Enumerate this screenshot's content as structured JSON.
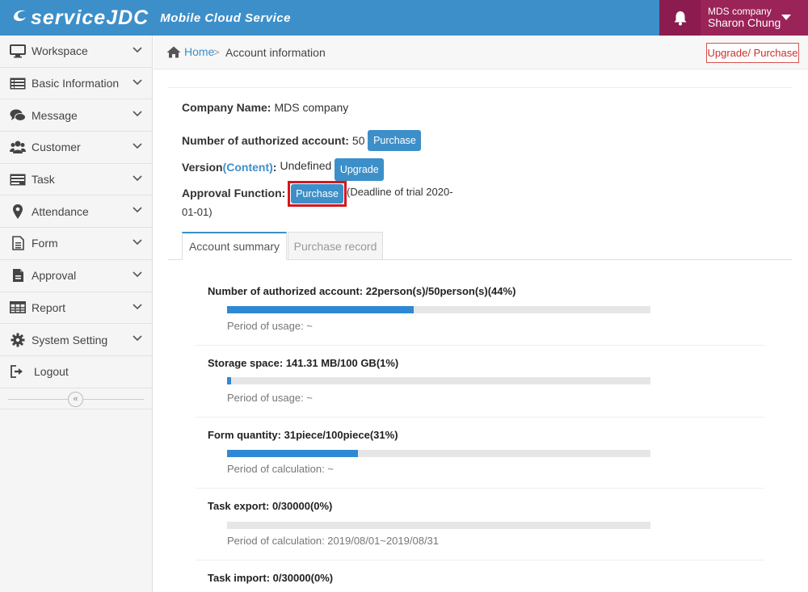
{
  "header": {
    "logo_text": "serviceJDC",
    "logo_sub": "Mobile Cloud Service",
    "user_company": "MDS company",
    "user_name": "Sharon Chung"
  },
  "sidebar": {
    "items": [
      {
        "label": "Workspace",
        "icon": "monitor-icon"
      },
      {
        "label": "Basic Information",
        "icon": "list-icon"
      },
      {
        "label": "Message",
        "icon": "chat-icon"
      },
      {
        "label": "Customer",
        "icon": "users-icon"
      },
      {
        "label": "Task",
        "icon": "task-icon"
      },
      {
        "label": "Attendance",
        "icon": "map-pin-icon"
      },
      {
        "label": "Form",
        "icon": "document-icon"
      },
      {
        "label": "Approval",
        "icon": "approval-doc-icon"
      },
      {
        "label": "Report",
        "icon": "table-icon"
      },
      {
        "label": "System Setting",
        "icon": "gear-icon"
      },
      {
        "label": "Logout",
        "icon": "logout-icon"
      }
    ],
    "collapse_glyph": "«"
  },
  "breadcrumb": {
    "home": "Home",
    "separator": ">",
    "current": "Account information",
    "upgrade_button": "Upgrade/ Purchase"
  },
  "info": {
    "company_label": "Company Name:",
    "company_value": "MDS company",
    "accounts_label": "Number of authorized account:",
    "accounts_value": "50",
    "purchase_button": "Purchase",
    "version_label_prefix": "Version",
    "version_label_link": "(Content)",
    "version_label_suffix": ":",
    "version_value": "Undefined",
    "upgrade_button": "Upgrade",
    "approval_label": "Approval Function:",
    "approval_button": "Purchase",
    "approval_note_line1": "(Deadline of trial 2020-",
    "approval_note_line2": "01-01)"
  },
  "tabs": {
    "summary": "Account summary",
    "purchase_record": "Purchase record"
  },
  "stats": [
    {
      "title": "Number of authorized account: 22person(s)/50person(s)(44%)",
      "percent": 44,
      "sub": "Period of usage: ~"
    },
    {
      "title": "Storage space: 141.31 MB/100 GB(1%)",
      "percent": 1,
      "sub": "Period of usage: ~"
    },
    {
      "title": "Form quantity: 31piece/100piece(31%)",
      "percent": 31,
      "sub": "Period of calculation: ~"
    },
    {
      "title": "Task export: 0/30000(0%)",
      "percent": 0,
      "sub": "Period of calculation: 2019/08/01~2019/08/31"
    },
    {
      "title": "Task import: 0/30000(0%)",
      "percent": 0,
      "sub": ""
    }
  ],
  "colors": {
    "header_blue": "#3d8fc9",
    "user_box": "#9a2358",
    "bell_box": "#8c1c4f",
    "progress_fill": "#2f88d4",
    "highlight_red": "#d2181d"
  }
}
